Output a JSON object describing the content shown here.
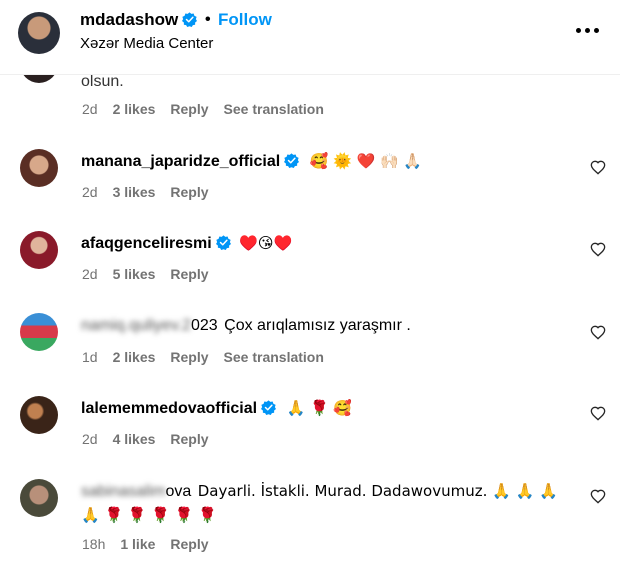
{
  "header": {
    "username": "mdadashow",
    "separator": "•",
    "follow_label": "Follow",
    "location": "Xəzər Media Center"
  },
  "comments": [
    {
      "text": "olsun.",
      "time": "2d",
      "likes": "2 likes",
      "reply": "Reply",
      "translation": "See translation"
    },
    {
      "username": "manana_japaridze_official",
      "text": "🥰 🌞 ❤️ 🙌🏻 🙏🏻",
      "time": "2d",
      "likes": "3 likes",
      "reply": "Reply"
    },
    {
      "username": "afaqgenceliresmi",
      "text": "♥️😘♥️",
      "time": "2d",
      "likes": "5 likes",
      "reply": "Reply"
    },
    {
      "username": "namiq.quliyev.2023",
      "username_visible": "023",
      "text": "Çox arıqlamısız yaraşmır .",
      "time": "1d",
      "likes": "2 likes",
      "reply": "Reply",
      "translation": "See translation"
    },
    {
      "username": "lalememmedovaofficial",
      "text": "🙏 🌹 🥰",
      "time": "2d",
      "likes": "4 likes",
      "reply": "Reply"
    },
    {
      "username": "sabinasalimova",
      "username_visible": "ova",
      "text": "Dayarli. İstakli. Murad. Dadawovumuz. 🙏 🙏 🙏",
      "text_line2": "🙏 🌹 🌹 🌹 🌹 🌹",
      "time": "18h",
      "likes": "1 like",
      "reply": "Reply"
    }
  ],
  "colors": {
    "follow": "#0095f6",
    "verified": "#0095f6",
    "meta": "#737373"
  }
}
